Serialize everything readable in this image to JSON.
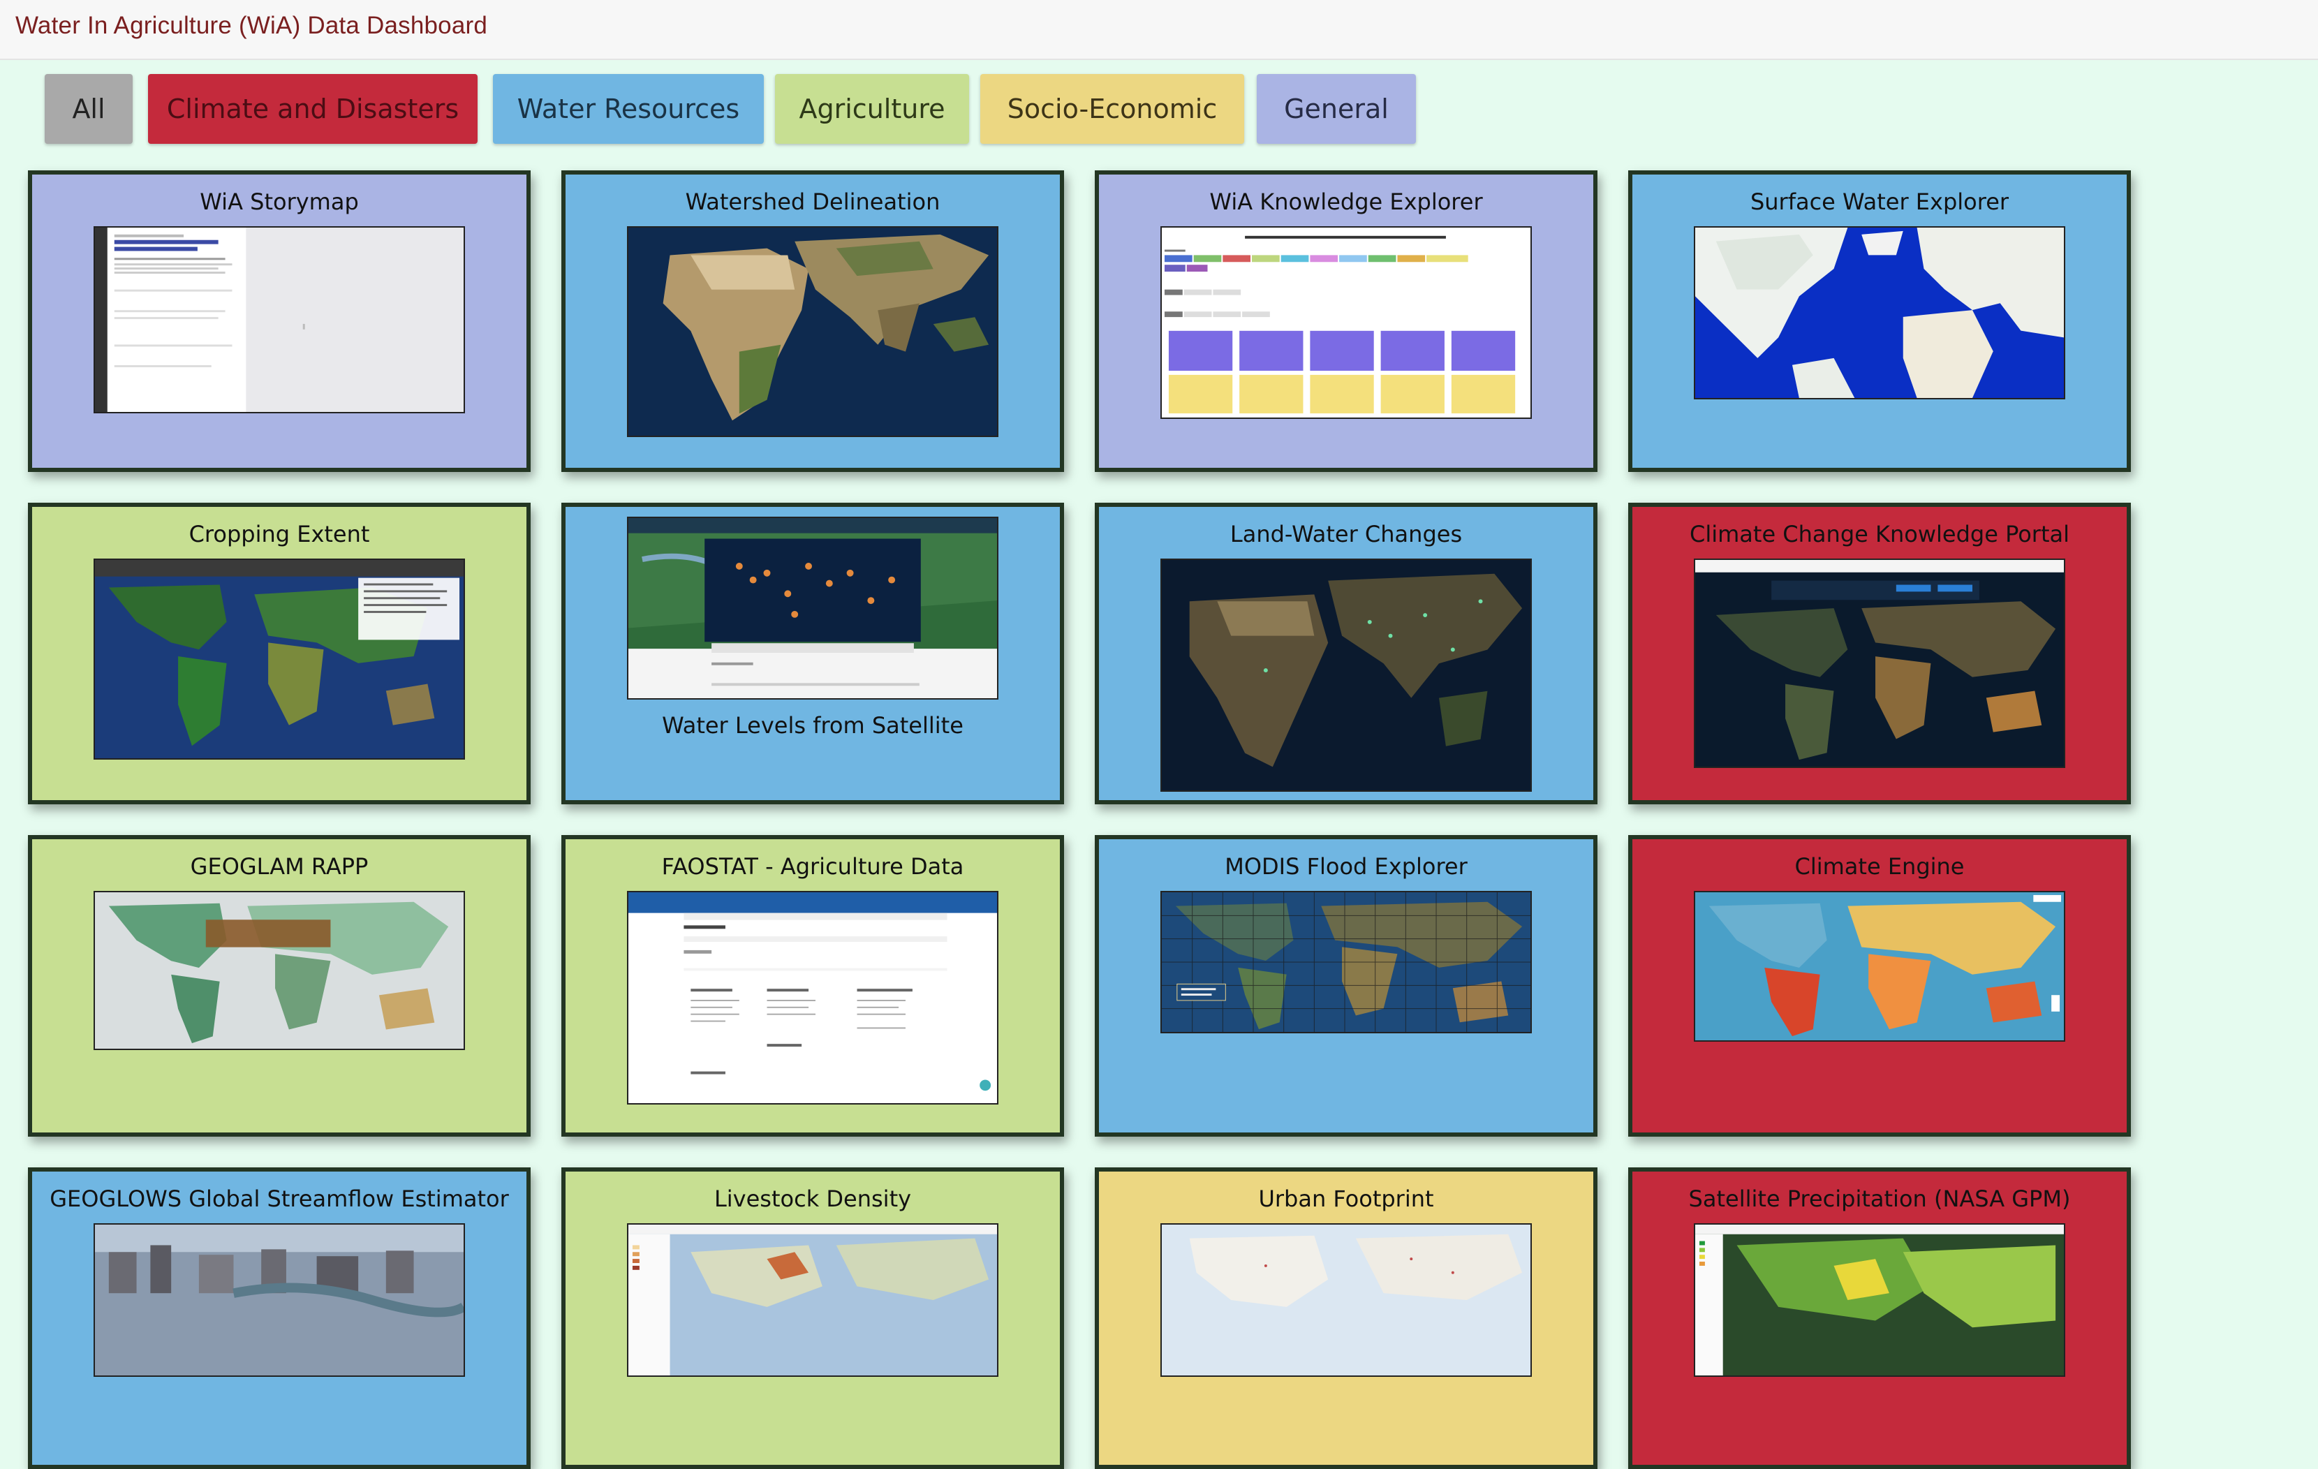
{
  "header": {
    "title": "Water In Agriculture (WiA) Data Dashboard"
  },
  "colors": {
    "all": "#a9a9a9",
    "climate": "#c42a3c",
    "water": "#70b6e2",
    "agriculture": "#c7df92",
    "socio": "#ecd782",
    "general": "#aab4e4",
    "tile_border": "#233623",
    "page_background": "#e5fbef"
  },
  "filters": [
    {
      "label": "All",
      "category": "all"
    },
    {
      "label": "Climate and Disasters",
      "category": "climate"
    },
    {
      "label": "Water Resources",
      "category": "water"
    },
    {
      "label": "Agriculture",
      "category": "agriculture"
    },
    {
      "label": "Socio-Economic",
      "category": "socio"
    },
    {
      "label": "General",
      "category": "general"
    }
  ],
  "tiles": [
    {
      "title": "WiA Storymap",
      "category": "general",
      "thumbnail": "storymap-screenshot"
    },
    {
      "title": "Watershed Delineation",
      "category": "water",
      "thumbnail": "satellite-africa-map"
    },
    {
      "title": "WiA Knowledge Explorer",
      "category": "general",
      "thumbnail": "knowledge-table-screenshot"
    },
    {
      "title": "Surface Water Explorer",
      "category": "water",
      "thumbnail": "atlantic-basemap"
    },
    {
      "title": "Cropping Extent",
      "category": "agriculture",
      "thumbnail": "cropland-world-map"
    },
    {
      "title": "Water Levels from Satellite",
      "category": "water",
      "thumbnail": "hydroweb-site"
    },
    {
      "title": "Land-Water Changes",
      "category": "water",
      "thumbnail": "dark-satellite-map"
    },
    {
      "title": "Climate Change Knowledge Portal",
      "category": "climate",
      "thumbnail": "dark-world-map"
    },
    {
      "title": "GEOGLAM RAPP",
      "category": "agriculture",
      "thumbnail": "rangeland-map"
    },
    {
      "title": "FAOSTAT - Agriculture Data",
      "category": "agriculture",
      "thumbnail": "faostat-site"
    },
    {
      "title": "MODIS Flood Explorer",
      "category": "water",
      "thumbnail": "flood-tile-grid"
    },
    {
      "title": "Climate Engine",
      "category": "climate",
      "thumbnail": "heatmap-world"
    },
    {
      "title": "GEOGLOWS Global Streamflow Estimator",
      "category": "water",
      "thumbnail": "city-aerial"
    },
    {
      "title": "Livestock Density",
      "category": "agriculture",
      "thumbnail": "livestock-map"
    },
    {
      "title": "Urban Footprint",
      "category": "socio",
      "thumbnail": "light-basemap"
    },
    {
      "title": "Satellite Precipitation (NASA GPM)",
      "category": "climate",
      "thumbnail": "precip-map"
    }
  ]
}
